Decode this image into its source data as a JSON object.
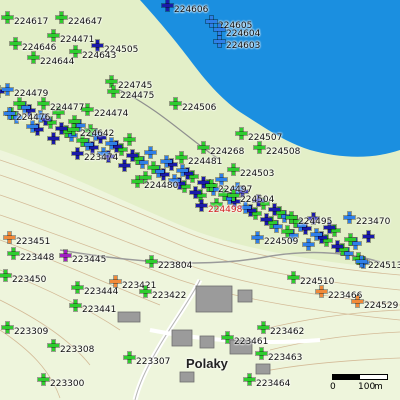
{
  "map": {
    "place_label": "Polaky",
    "scale": {
      "start": "0",
      "mid": "100",
      "unit": "m"
    },
    "colors": {
      "water": "#1b8fe0",
      "land": "#e3efc8",
      "marker_green": "#2ecc2e",
      "marker_navy": "#1a1aa8",
      "marker_blue": "#2f7fe8",
      "marker_orange": "#f08a3a",
      "marker_purple": "#a020c0",
      "label_highlight": "#d42020"
    },
    "markers": [
      {
        "id": "224617",
        "color": "green"
      },
      {
        "id": "224647",
        "color": "green"
      },
      {
        "id": "224606",
        "color": "navy"
      },
      {
        "id": "224605",
        "color": "blue"
      },
      {
        "id": "224604",
        "color": "blue"
      },
      {
        "id": "224603",
        "color": "blue"
      },
      {
        "id": "224646",
        "color": "green"
      },
      {
        "id": "224471",
        "color": "green"
      },
      {
        "id": "224505",
        "color": "navy"
      },
      {
        "id": "224644",
        "color": "green"
      },
      {
        "id": "224643",
        "color": "green"
      },
      {
        "id": "224745",
        "color": "green"
      },
      {
        "id": "224479",
        "color": "blue"
      },
      {
        "id": "224475",
        "color": "green"
      },
      {
        "id": "224477",
        "color": "green"
      },
      {
        "id": "224506",
        "color": "green"
      },
      {
        "id": "224474",
        "color": "green"
      },
      {
        "id": "224476",
        "color": "blue"
      },
      {
        "id": "224642",
        "color": "green"
      },
      {
        "id": "224507",
        "color": "green"
      },
      {
        "id": "224508",
        "color": "green"
      },
      {
        "id": "223474",
        "color": "navy"
      },
      {
        "id": "224268",
        "color": "green"
      },
      {
        "id": "224481",
        "color": "green"
      },
      {
        "id": "224503",
        "color": "green"
      },
      {
        "id": "224480",
        "color": "green"
      },
      {
        "id": "224497",
        "color": "green"
      },
      {
        "id": "224504",
        "color": "green"
      },
      {
        "id": "224498",
        "color": "navy",
        "highlight": true
      },
      {
        "id": "224495",
        "color": "green"
      },
      {
        "id": "223470",
        "color": "blue"
      },
      {
        "id": "223451",
        "color": "orange"
      },
      {
        "id": "224509",
        "color": "blue"
      },
      {
        "id": "224513",
        "color": "blue"
      },
      {
        "id": "223448",
        "color": "green"
      },
      {
        "id": "223445",
        "color": "purple"
      },
      {
        "id": "223804",
        "color": "green"
      },
      {
        "id": "223450",
        "color": "green"
      },
      {
        "id": "224510",
        "color": "green"
      },
      {
        "id": "223466",
        "color": "orange"
      },
      {
        "id": "223444",
        "color": "green"
      },
      {
        "id": "223421",
        "color": "orange"
      },
      {
        "id": "223422",
        "color": "green"
      },
      {
        "id": "224529",
        "color": "orange"
      },
      {
        "id": "223441",
        "color": "green"
      },
      {
        "id": "223309",
        "color": "green"
      },
      {
        "id": "223462",
        "color": "green"
      },
      {
        "id": "223308",
        "color": "green"
      },
      {
        "id": "223461",
        "color": "green"
      },
      {
        "id": "223307",
        "color": "green"
      },
      {
        "id": "223463",
        "color": "green"
      },
      {
        "id": "223300",
        "color": "green"
      },
      {
        "id": "223464",
        "color": "green"
      }
    ]
  }
}
